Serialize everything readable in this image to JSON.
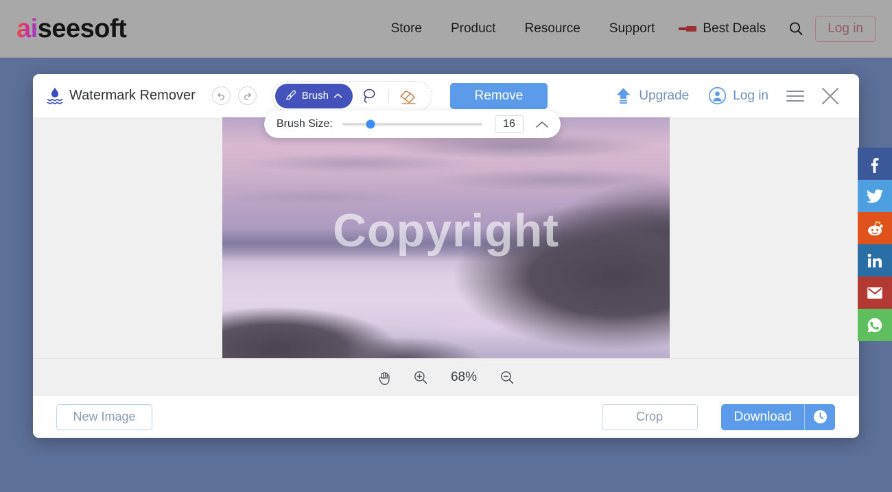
{
  "site_nav": {
    "brand_prefix": "ai",
    "brand_suffix": "seesoft",
    "links": [
      {
        "label": "Store"
      },
      {
        "label": "Product"
      },
      {
        "label": "Resource"
      },
      {
        "label": "Support"
      }
    ],
    "best_deals_label": "Best Deals",
    "search_icon": "search-icon",
    "login_label": "Log in",
    "bar_color": "#a8a8a8",
    "login_border_color": "#b4787f"
  },
  "page": {
    "background_color": "#5d7099"
  },
  "app": {
    "title": "Watermark Remover",
    "title_icon": "watermark-drop-icon",
    "undo_icon": "undo-arrow-icon",
    "redo_icon": "redo-arrow-icon",
    "toolbar": {
      "brush_label": "Brush",
      "brush_icon": "paintbrush-icon",
      "brush_chevron": "chevron-up-icon",
      "lasso_icon": "lasso-icon",
      "eraser_icon": "eraser-icon",
      "brush_active_color": "#4353bb"
    },
    "remove_label": "Remove",
    "remove_color": "#5b9bea",
    "header_right": {
      "upgrade_label": "Upgrade",
      "upgrade_icon": "upload-arrow-icon",
      "login_label": "Log in",
      "login_icon": "user-circle-icon",
      "menu_icon": "hamburger-menu-icon",
      "close_icon": "close-x-icon",
      "accent_color": "#6f8fb9"
    },
    "brush_size": {
      "label": "Brush Size:",
      "value": "16",
      "slider_percent": 20,
      "collapse_icon": "chevron-up-icon",
      "thumb_color": "#3b8df2"
    },
    "canvas": {
      "watermark_text": "Copyright",
      "image_alt": "purple sunset lake landscape with rocky shore"
    },
    "zoom_bar": {
      "hand_icon": "hand-pan-icon",
      "zoom_in_icon": "zoom-in-icon",
      "zoom_level": "68%",
      "zoom_out_icon": "zoom-out-icon"
    },
    "footer": {
      "new_image_label": "New Image",
      "crop_label": "Crop",
      "download_label": "Download",
      "download_history_icon": "clock-history-icon",
      "download_color": "#5b9bea"
    }
  },
  "social_rail": [
    {
      "name": "facebook",
      "glyph": "f",
      "color": "#3b5998"
    },
    {
      "name": "twitter",
      "glyph": "t",
      "color": "#4e9fe0"
    },
    {
      "name": "reddit",
      "glyph": "r",
      "color": "#e0521c"
    },
    {
      "name": "linkedin",
      "glyph": "in",
      "color": "#2a6ea6"
    },
    {
      "name": "gmail",
      "glyph": "M",
      "color": "#b33a32"
    },
    {
      "name": "whatsapp",
      "glyph": "w",
      "color": "#5fbf5f"
    }
  ]
}
